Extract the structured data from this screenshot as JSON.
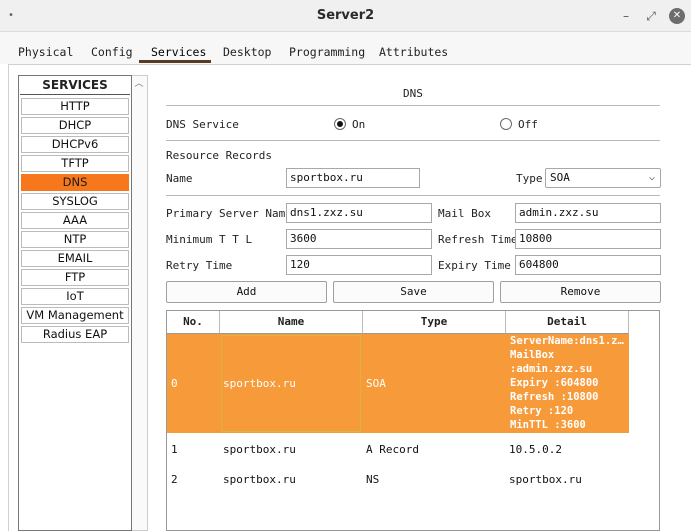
{
  "window": {
    "title": "Server2",
    "menu_dot": "•",
    "minimize": "–",
    "restore": "⤢",
    "close": "✕"
  },
  "tabs": [
    "Physical",
    "Config",
    "Services",
    "Desktop",
    "Programming",
    "Attributes"
  ],
  "active_tab": "Services",
  "sidebar": {
    "header": "SERVICES",
    "items": [
      "HTTP",
      "DHCP",
      "DHCPv6",
      "TFTP",
      "DNS",
      "SYSLOG",
      "AAA",
      "NTP",
      "EMAIL",
      "FTP",
      "IoT",
      "VM Management",
      "Radius EAP"
    ],
    "active": "DNS"
  },
  "dns": {
    "heading": "DNS",
    "service_label": "DNS Service",
    "on_label": "On",
    "off_label": "Off",
    "service_state": "On",
    "records_label": "Resource Records",
    "name_label": "Name",
    "name_value": "sportbox.ru",
    "type_label": "Type",
    "type_value": "SOA",
    "primary_label": "Primary Server Name",
    "primary_value": "dns1.zxz.su",
    "mailbox_label": "Mail Box",
    "mailbox_value": "admin.zxz.su",
    "minttl_label": "Minimum T T L",
    "minttl_value": "3600",
    "refresh_label": "Refresh Time",
    "refresh_value": "10800",
    "retry_label": "Retry Time",
    "retry_value": "120",
    "expiry_label": "Expiry Time",
    "expiry_value": "604800",
    "buttons": {
      "add": "Add",
      "save": "Save",
      "remove": "Remove"
    }
  },
  "table": {
    "headers": [
      "No.",
      "Name",
      "Type",
      "Detail"
    ],
    "rows": [
      {
        "no": "0",
        "name": "sportbox.ru",
        "type": "SOA",
        "detail": [
          "ServerName:dns1.z…",
          "MailBox",
          ":admin.zxz.su",
          "Expiry :604800",
          "Refresh :10800",
          "Retry :120",
          "MinTTL :3600"
        ]
      },
      {
        "no": "1",
        "name": "sportbox.ru",
        "type": "A Record",
        "detail": [
          "10.5.0.2"
        ]
      },
      {
        "no": "2",
        "name": "sportbox.ru",
        "type": "NS",
        "detail": [
          "sportbox.ru"
        ]
      }
    ]
  },
  "colors": {
    "accent": "#f7781c",
    "selected_row": "#f79a3a",
    "tab_underline": "#5b3a22"
  }
}
